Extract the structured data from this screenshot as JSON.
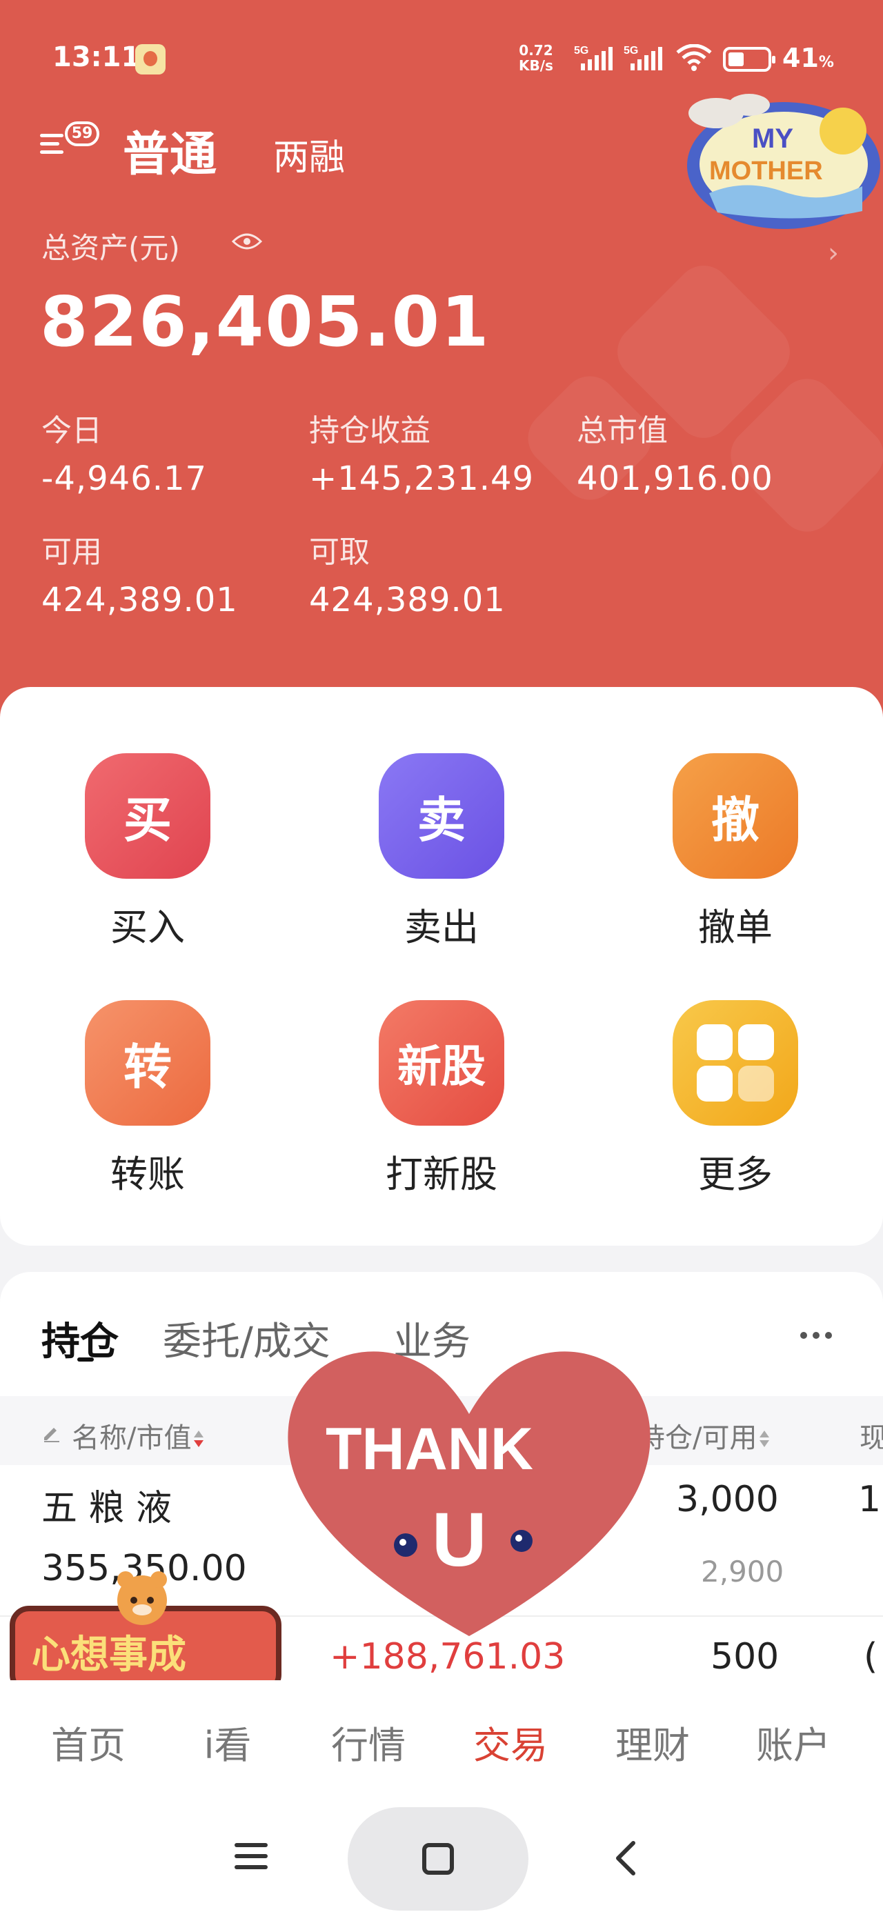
{
  "status_bar": {
    "time": "13:11",
    "net_speed": "0.72",
    "net_unit": "KB/s",
    "net_type_1": "5G",
    "net_type_2": "5G",
    "battery": "41",
    "battery_unit": "%",
    "battery_level": 0.41
  },
  "header": {
    "menu_badge": "59",
    "tab_ordinary": "普通",
    "tab_margin": "两融",
    "asset_label": "总资产(元)",
    "total_assets": "826,405.01",
    "chevron": "›"
  },
  "stats": {
    "today_label": "今日",
    "today_value": "-4,946.17",
    "holding_pl_label": "持仓收益",
    "holding_pl_value": "+145,231.49",
    "market_value_label": "总市值",
    "market_value_value": "401,916.00",
    "available_label": "可用",
    "available_value": "424,389.01",
    "withdrawable_label": "可取",
    "withdrawable_value": "424,389.01"
  },
  "actions": [
    {
      "icon_text": "买",
      "label": "买入",
      "color": "#e54f5b"
    },
    {
      "icon_text": "卖",
      "label": "卖出",
      "color": "#7a63ec"
    },
    {
      "icon_text": "撤",
      "label": "撤单",
      "color": "#f08c35"
    },
    {
      "icon_text": "转",
      "label": "转账",
      "color": "#f07a4e"
    },
    {
      "icon_text": "新股",
      "label": "打新股",
      "color": "#ee6154"
    },
    {
      "icon_text": "",
      "label": "更多",
      "color": "#f6b52e"
    }
  ],
  "positions": {
    "tabs": [
      "持仓",
      "委托/成交",
      "业务"
    ],
    "columns": [
      "名称/市值",
      "持仓/可用",
      "现"
    ],
    "rows": [
      {
        "name": "五 粮 液",
        "market_value": "355,350.00",
        "holding": "3,000",
        "available": "2,900",
        "price_partial": "1"
      },
      {
        "profit": "+188,761.03",
        "holding": "500",
        "price_partial": "("
      }
    ]
  },
  "stickers": {
    "mother_line1": "MY",
    "mother_line2": "MOTHER",
    "heart_text": "THANK",
    "heart_letter": "U",
    "wish_text": "心想事成"
  },
  "bottom_nav": {
    "items": [
      "首页",
      "i看",
      "行情",
      "交易",
      "理财",
      "账户"
    ],
    "active": "交易"
  },
  "colors": {
    "header_bg": "#dc5a4e",
    "accent_red": "#d94234",
    "profit_red": "#e03e3e"
  }
}
